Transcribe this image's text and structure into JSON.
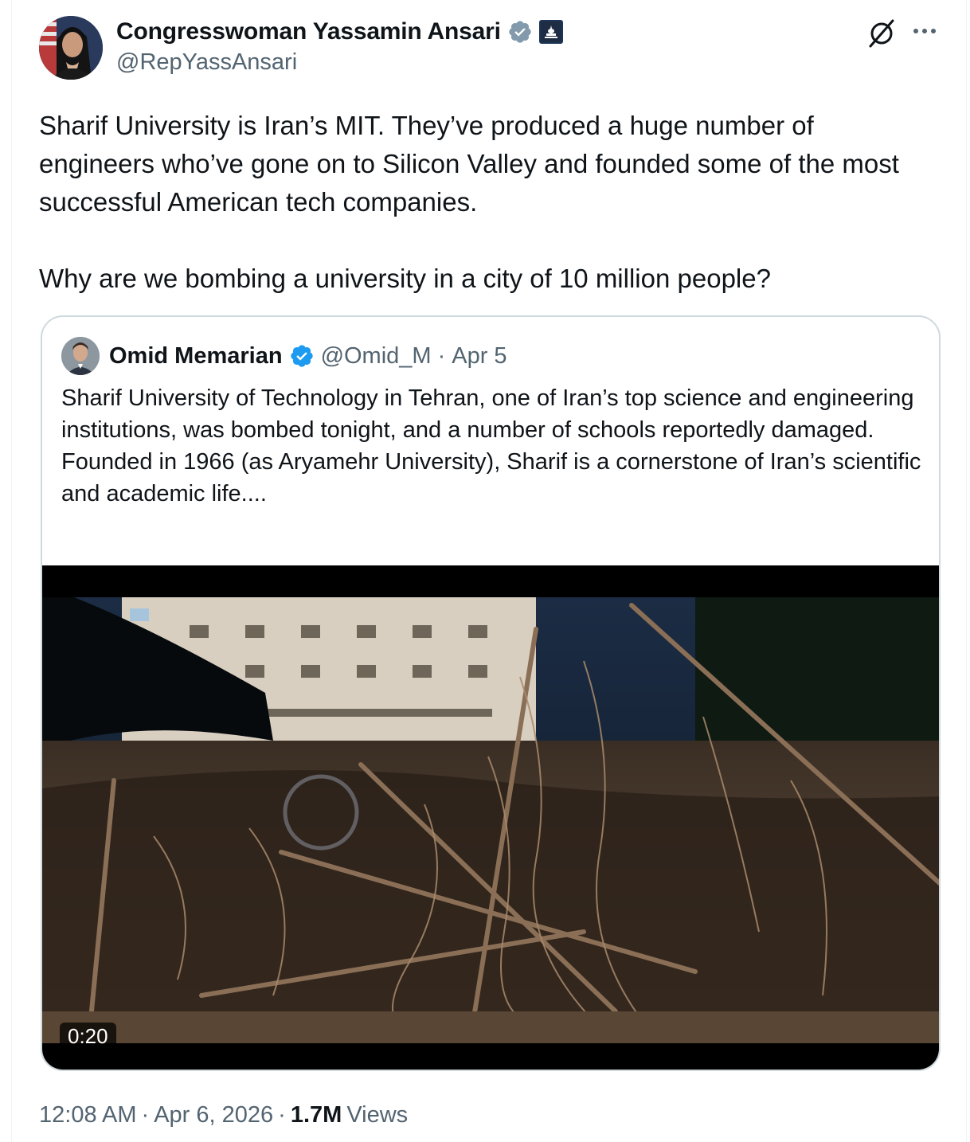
{
  "author": {
    "name": "Congresswoman Yassamin Ansari",
    "handle": "@RepYassAnsari",
    "verified_color": "#829aab"
  },
  "tweet": {
    "paragraphs": [
      "Sharif University is Iran’s MIT. They’ve produced a huge number of engineers who’ve gone on to Silicon Valley and founded some of the most successful American tech companies.",
      "Why are we bombing a university in a city of 10 million people?"
    ]
  },
  "quoted": {
    "name": "Omid Memarian",
    "handle": "@Omid_M",
    "separator": "·",
    "date": "Apr 5",
    "verified_color": "#1d9bf0",
    "lines": [
      "Sharif University of Technology in Tehran, one of Iran’s top science and engineering institutions, was bombed tonight, and a number of schools reportedly damaged.",
      "Founded in 1966 (as Aryamehr University), Sharif is a cornerstone of Iran’s scientific and academic life...."
    ],
    "video": {
      "duration": "0:20"
    }
  },
  "meta": {
    "time": "12:08 AM",
    "separator": "·",
    "date": "Apr 6, 2026",
    "views_count": "1.7M",
    "views_label": "Views"
  },
  "icons": {
    "grok": "grok-icon",
    "more": "more-icon",
    "verified": "verified-badge-icon",
    "affiliate": "capitol-affiliate-icon"
  }
}
